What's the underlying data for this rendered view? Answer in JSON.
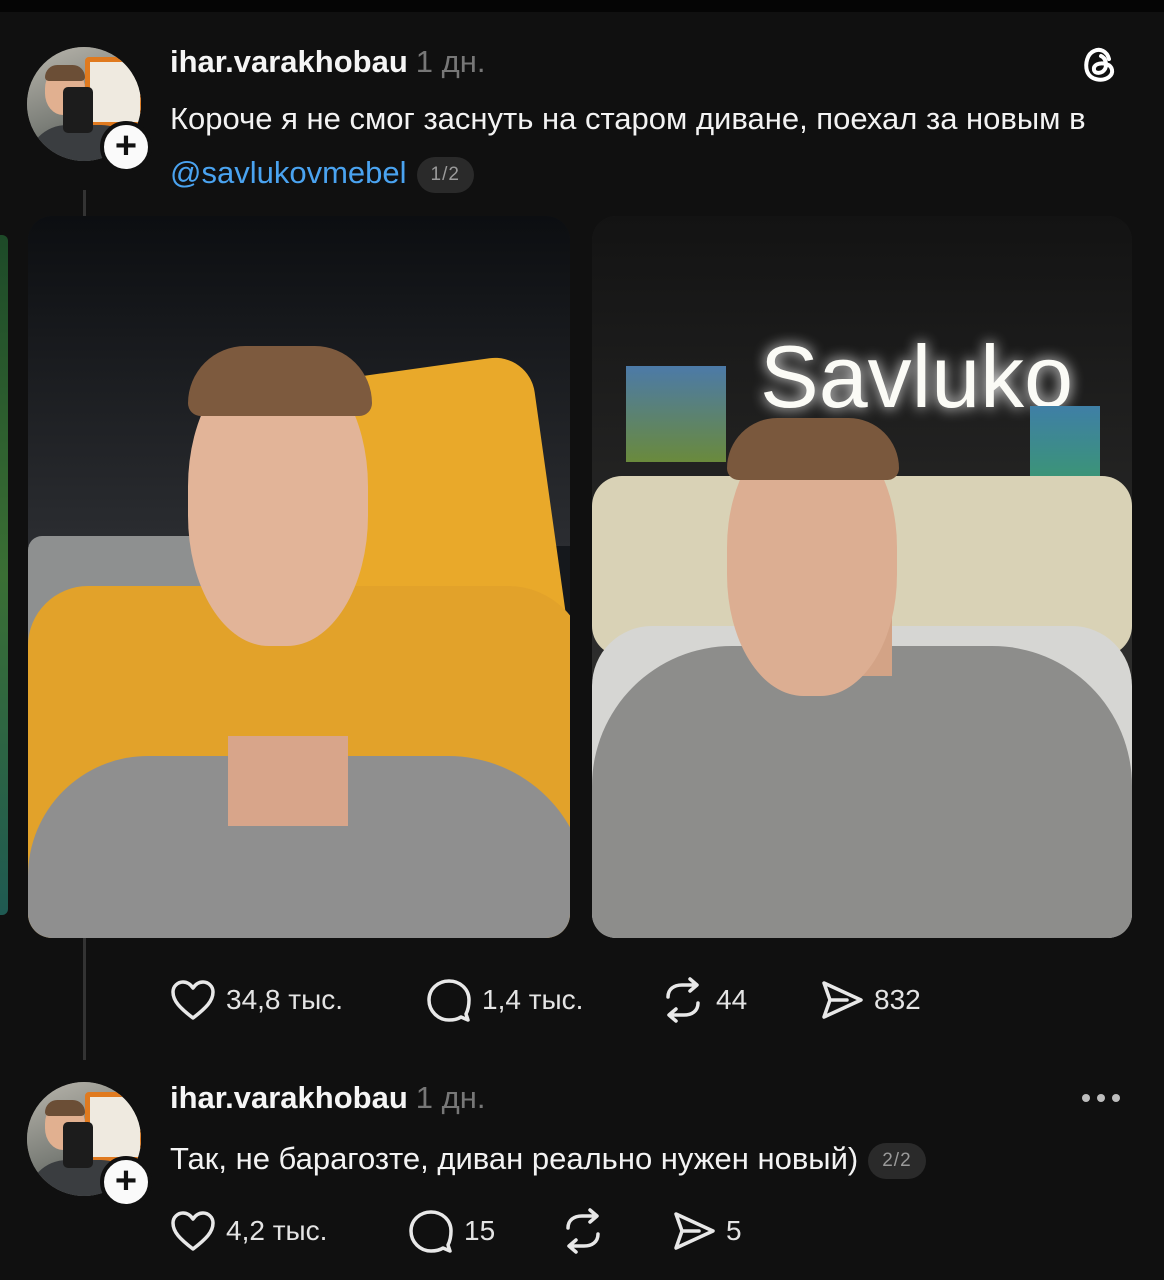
{
  "posts": [
    {
      "username": "ihar.varakhobau",
      "time": "1 дн.",
      "text_before": "Короче я не смог заснуть на старом диване, поехал за новым в ",
      "mention": "@savlukovmebel",
      "counter": "1/2",
      "photo_sign": "Savluko",
      "actions": {
        "likes": "34,8 тыс.",
        "replies": "1,4 тыс.",
        "reposts": "44",
        "shares": "832"
      }
    },
    {
      "username": "ihar.varakhobau",
      "time": "1 дн.",
      "text": "Так, не барагозте, диван реально нужен новый)",
      "counter": "2/2",
      "actions": {
        "likes": "4,2 тыс.",
        "replies": "15",
        "reposts": "",
        "shares": "5"
      }
    }
  ],
  "icons": {
    "app_logo": "threads-icon",
    "menu": "more-icon",
    "like": "heart-icon",
    "reply": "comment-icon",
    "repost": "repost-icon",
    "share": "send-icon",
    "follow": "plus-icon"
  },
  "colors": {
    "background": "#101010",
    "mention": "#4aa3f0",
    "muted": "#777777"
  }
}
